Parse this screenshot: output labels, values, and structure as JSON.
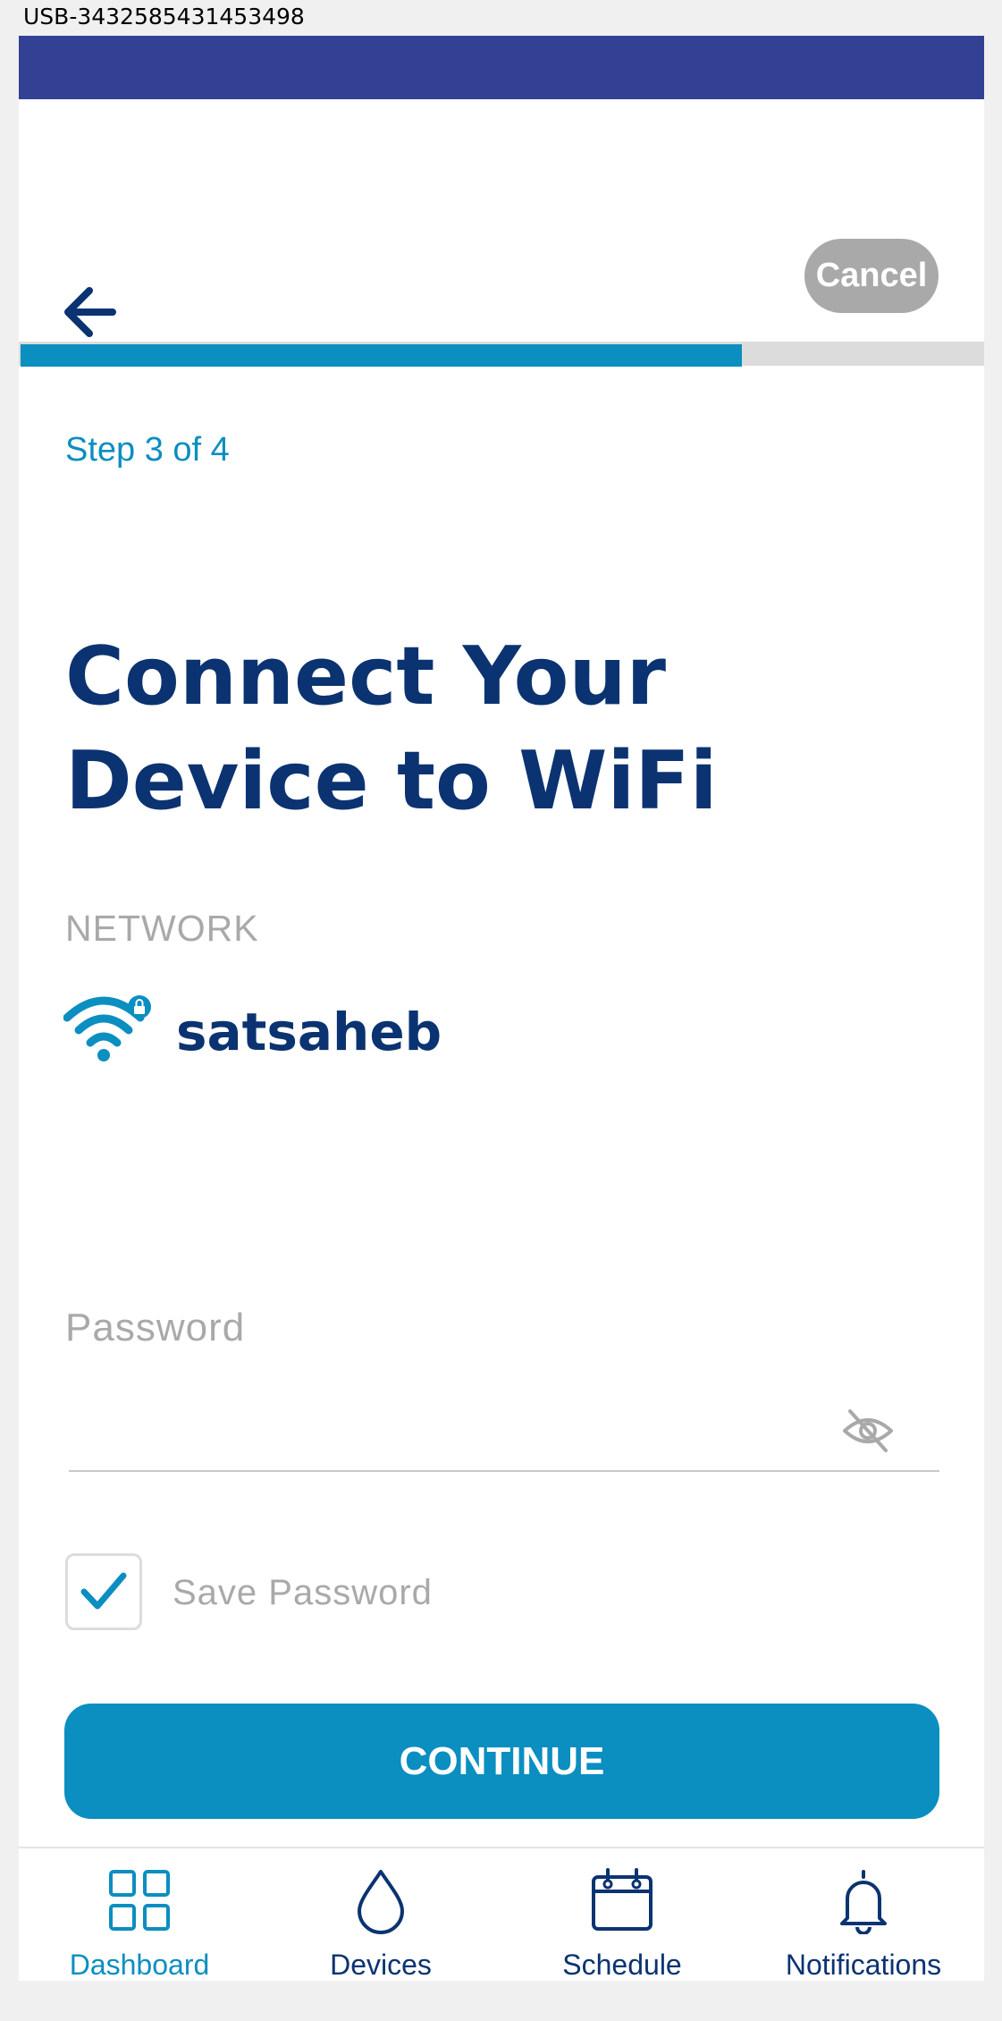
{
  "device_id": "USB-3432585431453498",
  "header": {
    "back_icon": "arrow-left-icon",
    "cancel_label": "Cancel"
  },
  "progress": {
    "fraction": 0.75
  },
  "step_text": "Step 3 of 4",
  "title_line1": "Connect Your",
  "title_line2": "Device to WiFi",
  "network": {
    "label": "NETWORK",
    "icon": "wifi-lock-icon",
    "name": "satsaheb"
  },
  "password": {
    "label": "Password",
    "value": "",
    "toggle_icon": "eye-off-icon"
  },
  "save_password": {
    "checked": true,
    "label": "Save Password"
  },
  "continue_label": "CONTINUE",
  "bottom_nav": [
    {
      "label": "Dashboard",
      "icon": "grid-icon",
      "active": true
    },
    {
      "label": "Devices",
      "icon": "water-drop-icon",
      "active": false
    },
    {
      "label": "Schedule",
      "icon": "calendar-icon",
      "active": false
    },
    {
      "label": "Notifications",
      "icon": "bell-icon",
      "active": false
    }
  ],
  "colors": {
    "status_bar": "#334194",
    "accent": "#0b8ec0",
    "title": "#0b3371",
    "muted": "#a9a9a9",
    "cancel_bg": "#a9a9a9"
  }
}
